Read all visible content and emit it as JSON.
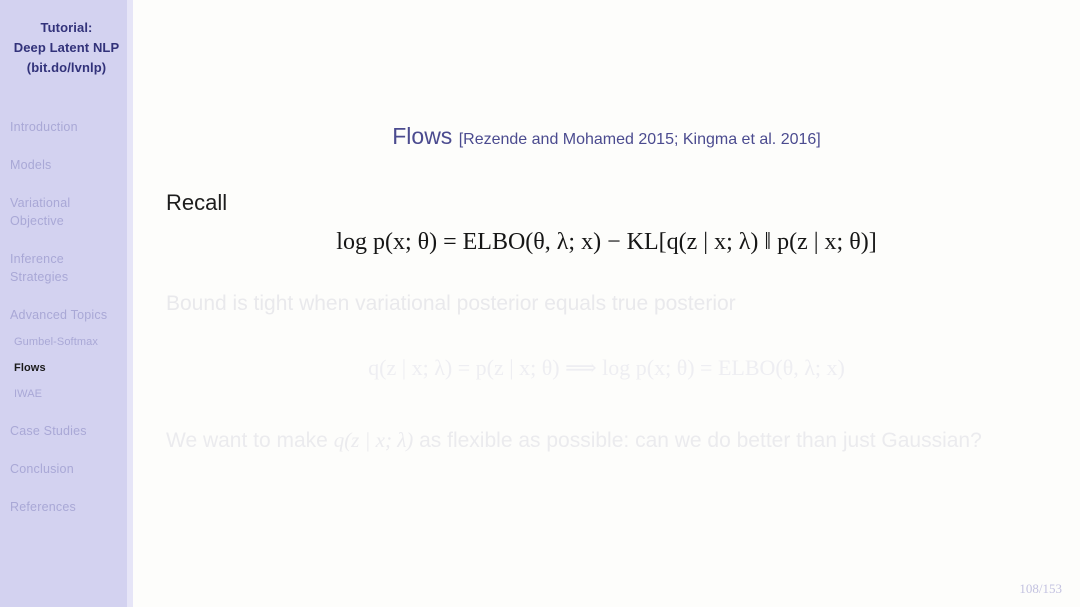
{
  "sidebar": {
    "title_lines": [
      "Tutorial:",
      "Deep Latent NLP",
      "(bit.do/lvnlp)"
    ],
    "items": [
      {
        "label": "Introduction",
        "active": false
      },
      {
        "label": "Models",
        "active": false
      },
      {
        "label": "Variational",
        "label2": "Objective",
        "active": false
      },
      {
        "label": "Inference",
        "label2": "Strategies",
        "active": false
      },
      {
        "label": "Advanced Topics",
        "active": false
      },
      {
        "label": "Case Studies",
        "active": false
      },
      {
        "label": "Conclusion",
        "active": false
      },
      {
        "label": "References",
        "active": false
      }
    ],
    "subitems": [
      {
        "label": "Gumbel-Softmax",
        "active": false
      },
      {
        "label": "Flows",
        "active": true
      },
      {
        "label": "IWAE",
        "active": false
      }
    ],
    "colors": {
      "background": "#d3d2f0",
      "title_text": "#32327a",
      "inactive_text": "#a9a8d6",
      "active_text": "#1a1a1a"
    }
  },
  "slide": {
    "title": "Flows",
    "title_citation": "[Rezende and Mohamed 2015; Kingma et al. 2016]",
    "title_color": "#4b4b8f",
    "recall_heading": "Recall",
    "equation_main": "log p(x; θ) = ELBO(θ, λ; x) − KL[q(z | x; λ) ‖ p(z | x; θ)]",
    "bullet_1": "Bound is tight when variational posterior equals true posterior",
    "equation_faded": "q(z | x; λ) = p(z | x; θ)  ⟹  log p(x; θ) = ELBO(θ, λ; x)",
    "paragraph_pre": "We want to make ",
    "paragraph_math": "q(z | x; λ)",
    "paragraph_post": " as flexible as possible: can we do better than just Gaussian?",
    "page_number": "108/153"
  }
}
